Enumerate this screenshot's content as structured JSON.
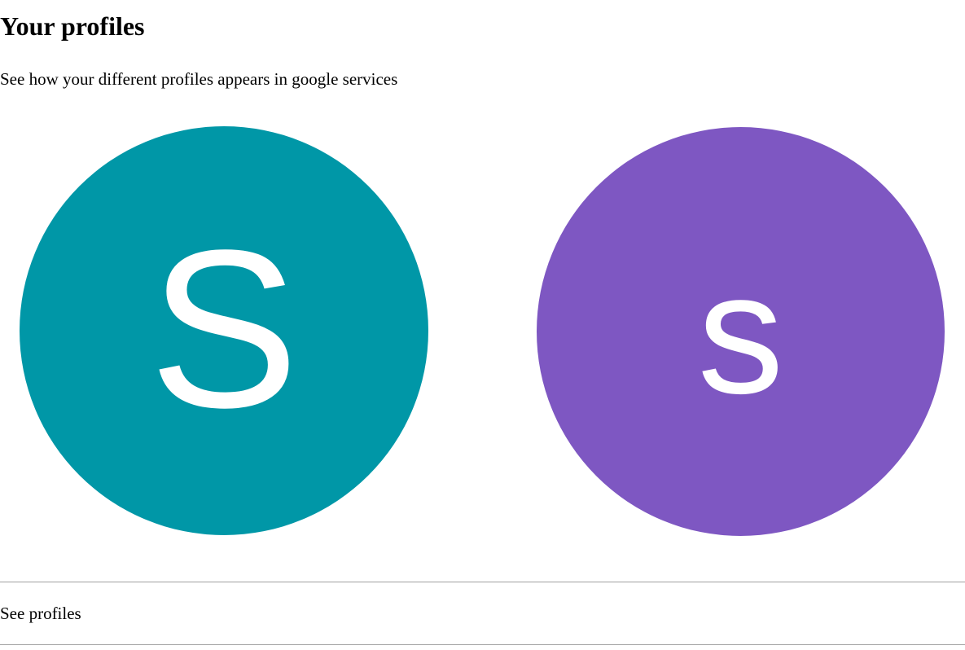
{
  "header": {
    "title": "Your profiles",
    "subtitle": "See how your different profiles appears in google services"
  },
  "profiles": [
    {
      "initial": "S",
      "color": "#0097a7"
    },
    {
      "initial": "s",
      "color": "#7e57c2"
    }
  ],
  "footer": {
    "see_profiles_label": "See profiles"
  }
}
